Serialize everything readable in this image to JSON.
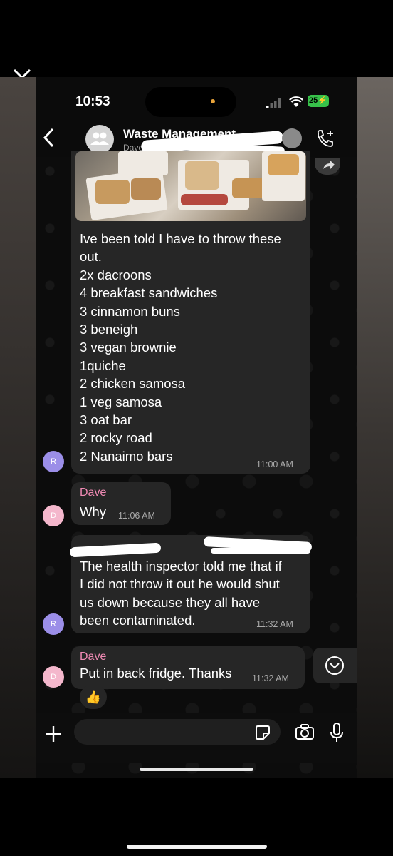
{
  "status_bar": {
    "time": "10:53",
    "battery": "25"
  },
  "header": {
    "title": "Waste Management",
    "subtitle": "Dave"
  },
  "messages": [
    {
      "lines": [
        "Ive been told I have to throw these",
        "out.",
        "2x dacroons",
        "4 breakfast sandwiches",
        "3 cinnamon buns",
        "3 beneigh",
        "3 vegan brownie",
        "1quiche",
        "2 chicken samosa",
        "1 veg samosa",
        "3 oat bar",
        "2 rocky road",
        "2 Nanaimo bars"
      ],
      "time": "11:00 AM",
      "avatar": "R"
    },
    {
      "sender": "Dave",
      "text": "Why",
      "time": "11:06 AM",
      "avatar": "D"
    },
    {
      "lines": [
        "The health inspector told me that if",
        "I did not throw it out he would shut",
        "us down because they all have",
        "been contaminated."
      ],
      "time": "11:32 AM",
      "avatar": "R"
    },
    {
      "sender": "Dave",
      "text": "Put in back fridge. Thanks",
      "time": "11:32 AM",
      "avatar": "D",
      "reaction": "👍"
    }
  ],
  "colors": {
    "bubble": "#262626",
    "sender_name": "#f08ab4",
    "avatar_r": "#9b8ee8",
    "avatar_d": "#f4b7cc",
    "battery": "#37c24a"
  }
}
